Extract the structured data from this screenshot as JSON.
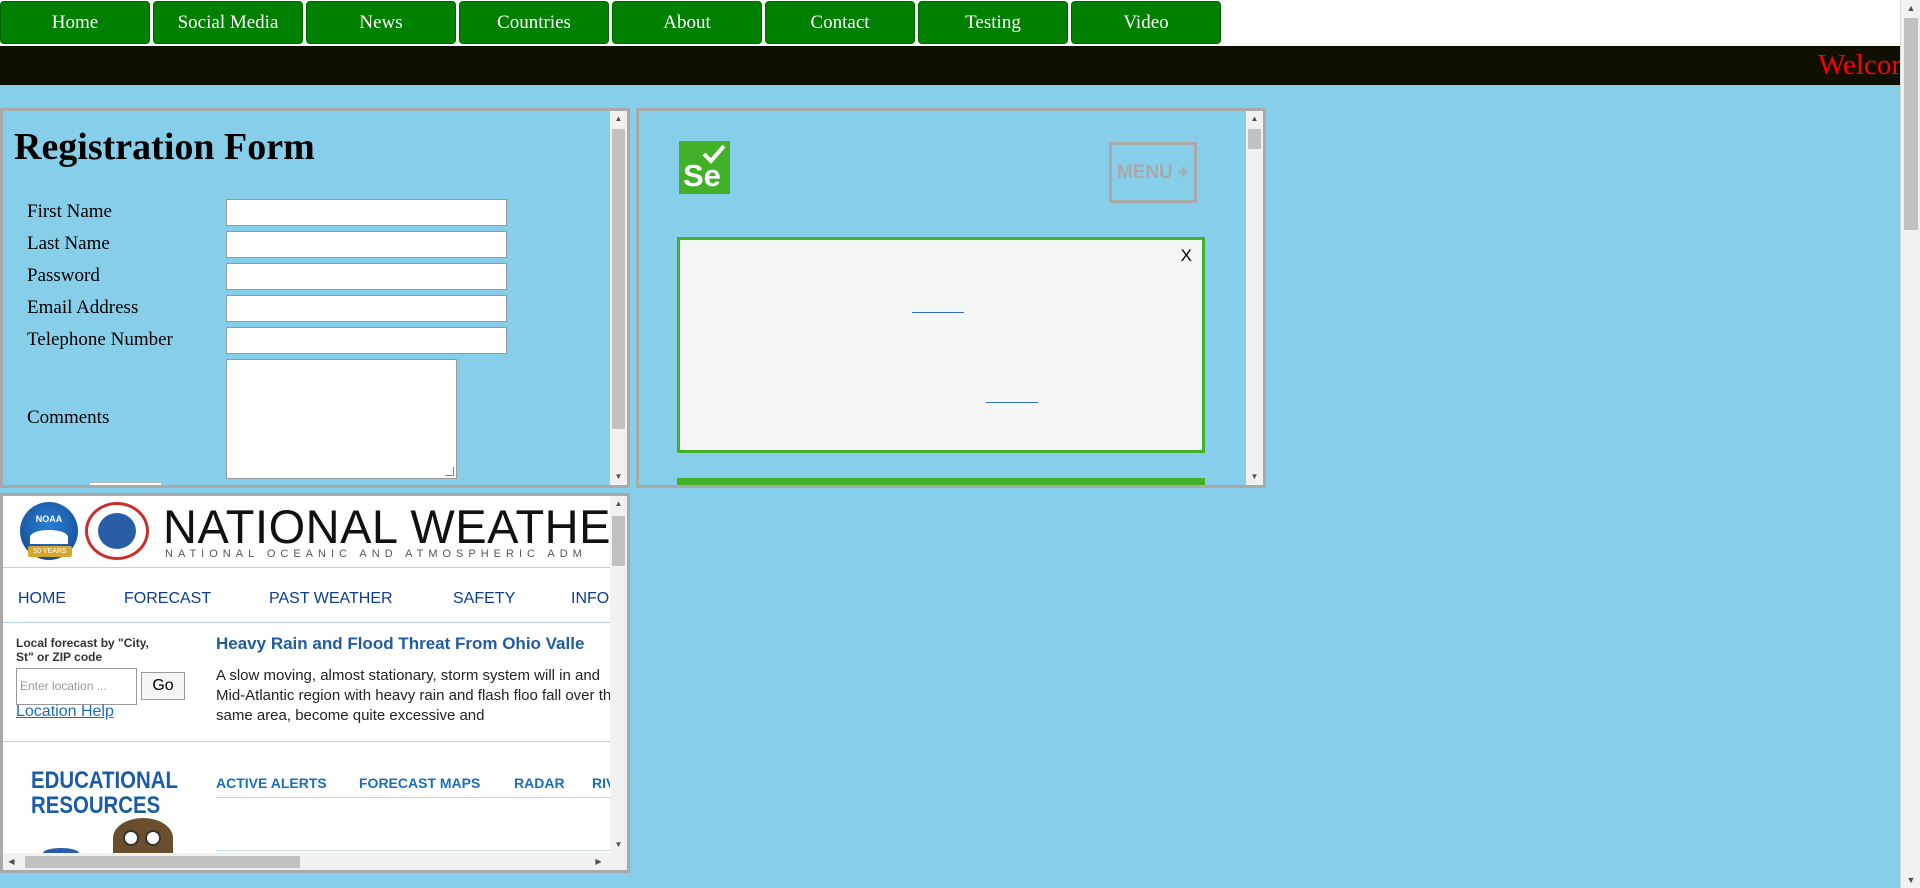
{
  "nav": {
    "items": [
      "Home",
      "Social Media",
      "News",
      "Countries",
      "About",
      "Contact",
      "Testing",
      "Video"
    ]
  },
  "marquee": {
    "text": "Welcome"
  },
  "registration": {
    "title": "Registration Form",
    "fields": [
      "First Name",
      "Last Name",
      "Password",
      "Email Address",
      "Telephone Number",
      "Comments"
    ]
  },
  "selenium": {
    "logo": "Se",
    "menu_label": "MENU +",
    "popup_close": "X"
  },
  "weather": {
    "noaa_text": "NOAA",
    "noaa_ribbon": "50 YEARS",
    "title": "NATIONAL WEATHER",
    "subtitle": "NATIONAL OCEANIC AND ATMOSPHERIC ADM",
    "nav": [
      "HOME",
      "FORECAST",
      "PAST WEATHER",
      "SAFETY",
      "INFO"
    ],
    "local_label": "Local forecast by \"City, St\" or ZIP code",
    "location_placeholder": "Enter location ...",
    "go_label": "Go",
    "location_help": "Location Help",
    "story_title": "Heavy Rain and Flood Threat From Ohio Valle",
    "story_text": "A slow moving, almost stationary, storm system will in and Mid-Atlantic region with heavy rain and flash floo fall over the same area, become quite excessive and",
    "edu_line1": "EDUCATIONAL",
    "edu_line2": "RESOURCES",
    "quick_nav": [
      "ACTIVE ALERTS",
      "FORECAST MAPS",
      "RADAR",
      "RIV"
    ]
  },
  "colors": {
    "page_bg": "#87ceeb",
    "nav_green": "#008000",
    "marquee_bg": "#0f1000",
    "marquee_text": "#ff0000",
    "selenium_green": "#43b02a"
  }
}
